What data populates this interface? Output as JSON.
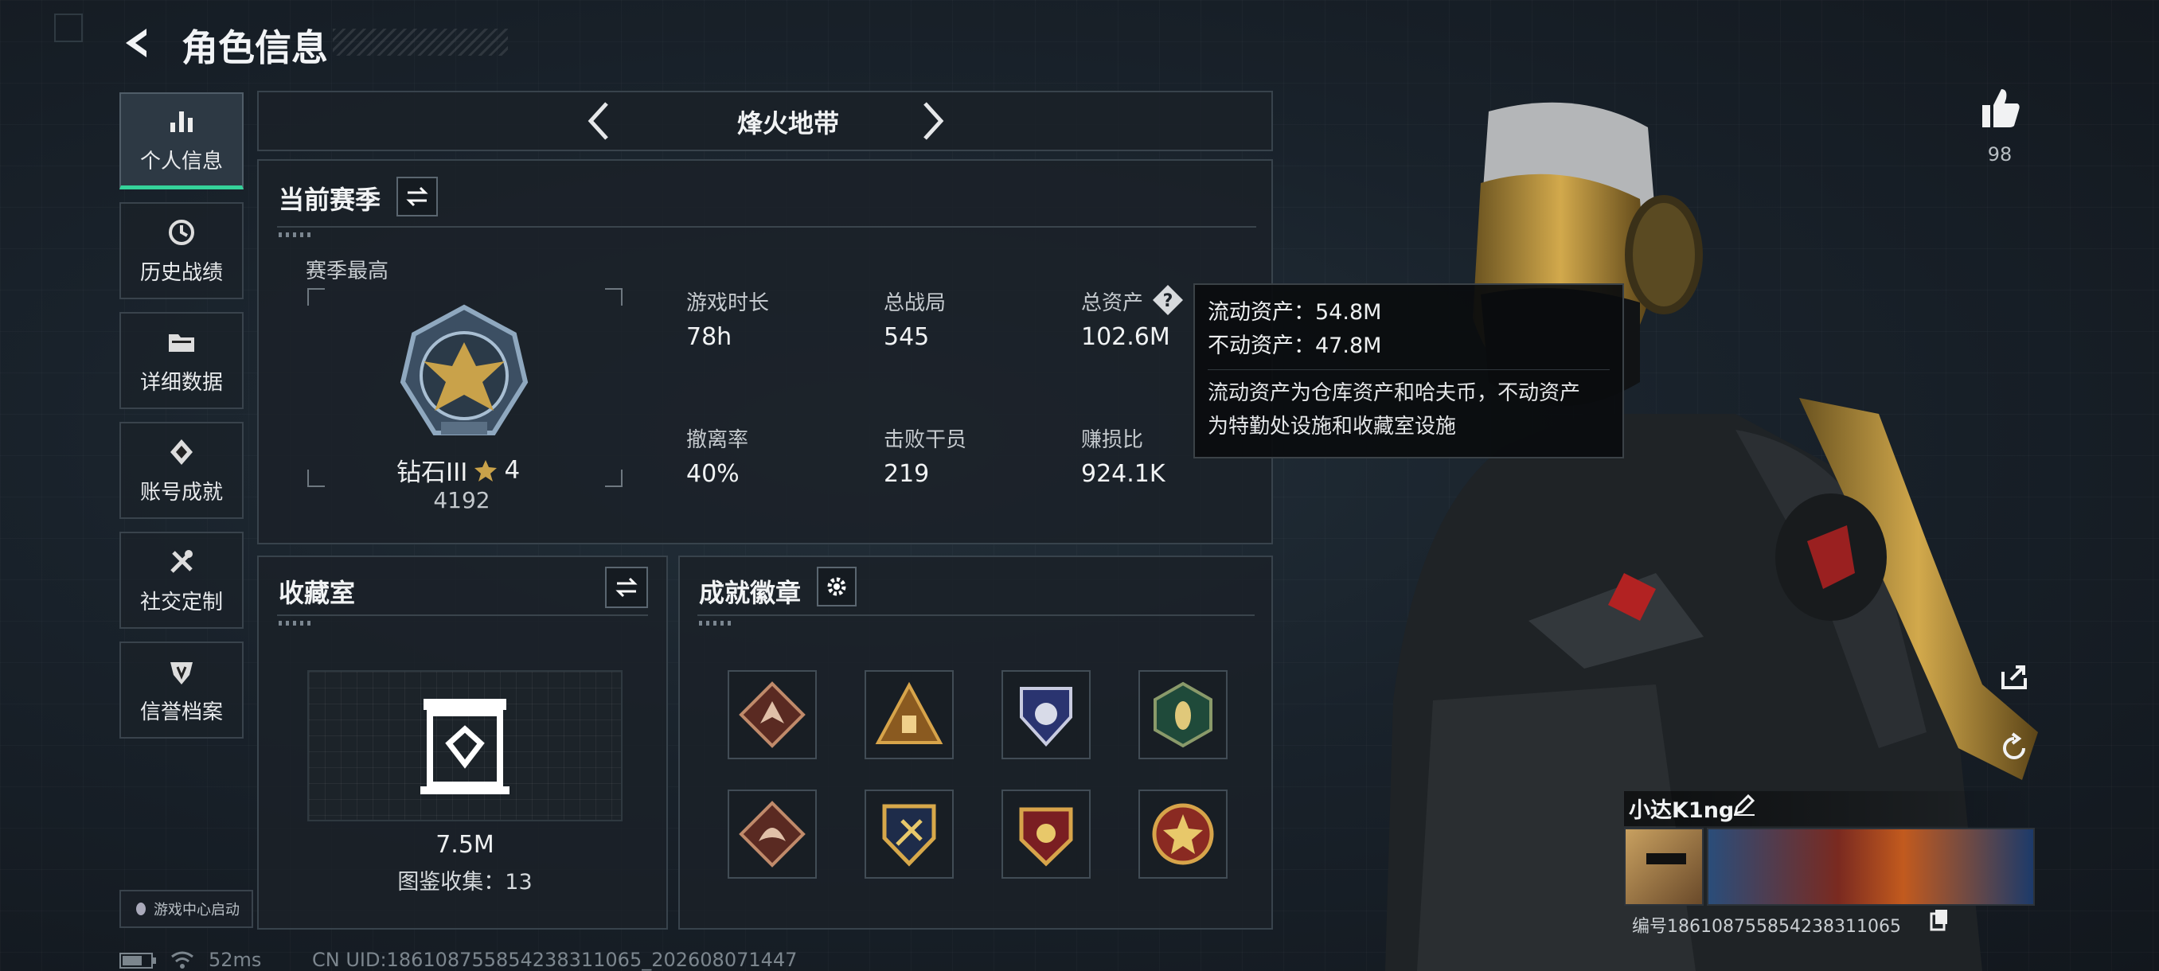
{
  "header": {
    "title": "角色信息"
  },
  "sidebar": {
    "items": [
      {
        "label": "个人信息",
        "icon": "bar-chart-icon",
        "active": true
      },
      {
        "label": "历史战绩",
        "icon": "history-icon"
      },
      {
        "label": "详细数据",
        "icon": "folder-icon"
      },
      {
        "label": "账号成就",
        "icon": "achievement-icon"
      },
      {
        "label": "社交定制",
        "icon": "tools-icon"
      },
      {
        "label": "信誉档案",
        "icon": "shield-icon"
      }
    ],
    "launch_label": "游戏中心启动"
  },
  "mode": {
    "label": "烽火地带"
  },
  "season": {
    "title": "当前赛季",
    "best_label": "赛季最高",
    "rank_name": "钻石III",
    "rank_stars": "4",
    "rank_score": "4192",
    "stats": [
      {
        "label": "游戏时长",
        "value": "78h"
      },
      {
        "label": "总战局",
        "value": "545"
      },
      {
        "label": "总资产",
        "value": "102.6M"
      },
      {
        "label": "撤离率",
        "value": "40%"
      },
      {
        "label": "击败干员",
        "value": "219"
      },
      {
        "label": "赚损比",
        "value": "924.1K"
      }
    ]
  },
  "tooltip": {
    "liquid": "流动资产：54.8M",
    "fixed": "不动资产：47.8M",
    "desc1": "流动资产为仓库资产和哈夫币，不动资产",
    "desc2": "为特勤处设施和收藏室设施"
  },
  "collection": {
    "title": "收藏室",
    "value": "7.5M",
    "count_label": "图鉴收集：13"
  },
  "badges": {
    "title": "成就徽章"
  },
  "profile": {
    "likes": "98",
    "name": "小达K1ng",
    "id_text": "编号18610875585423831106​5"
  },
  "status": {
    "ping": "52ms",
    "uid": "CN UID:18610875585423831106​5_202608071447"
  },
  "colors": {
    "accent": "#35d39a",
    "gold": "#c9a24a",
    "panel": "#1b2128"
  }
}
